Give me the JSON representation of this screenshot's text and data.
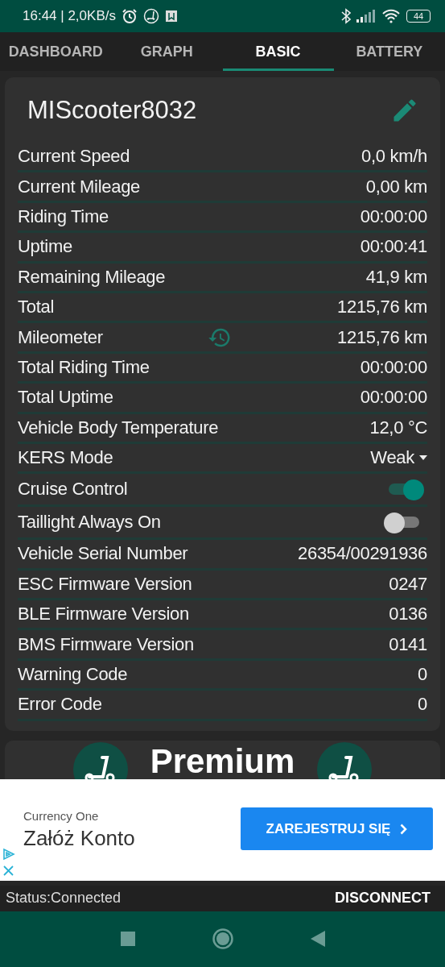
{
  "status_bar": {
    "time": "16:44 | 2,0KB/s",
    "battery": "44"
  },
  "tabs": [
    {
      "label": "DASHBOARD",
      "selected": false
    },
    {
      "label": "GRAPH",
      "selected": false
    },
    {
      "label": "BASIC",
      "selected": true
    },
    {
      "label": "BATTERY",
      "selected": false
    }
  ],
  "device": {
    "name": "MIScooter8032"
  },
  "rows": [
    {
      "kind": "value",
      "label": "Current Speed",
      "value": "0,0 km/h"
    },
    {
      "kind": "value",
      "label": "Current Mileage",
      "value": "0,00 km"
    },
    {
      "kind": "value",
      "label": "Riding Time",
      "value": "00:00:00"
    },
    {
      "kind": "value",
      "label": "Uptime",
      "value": "00:00:41"
    },
    {
      "kind": "value",
      "label": "Remaining Mileage",
      "value": "41,9 km"
    },
    {
      "kind": "value",
      "label": "Total",
      "value": "1215,76 km"
    },
    {
      "kind": "resettable",
      "label": "Mileometer",
      "value": "1215,76 km"
    },
    {
      "kind": "value",
      "label": "Total Riding Time",
      "value": "00:00:00"
    },
    {
      "kind": "value",
      "label": "Total Uptime",
      "value": "00:00:00"
    },
    {
      "kind": "value",
      "label": "Vehicle Body Temperature",
      "value": "12,0 °C"
    },
    {
      "kind": "dropdown",
      "label": "KERS Mode",
      "value": "Weak"
    },
    {
      "kind": "toggle",
      "label": "Cruise Control",
      "on": true
    },
    {
      "kind": "toggle",
      "label": "Taillight Always On",
      "on": false
    },
    {
      "kind": "value",
      "label": "Vehicle Serial Number",
      "value": "26354/00291936"
    },
    {
      "kind": "value",
      "label": "ESC Firmware Version",
      "value": "0247"
    },
    {
      "kind": "value",
      "label": "BLE Firmware Version",
      "value": "0136"
    },
    {
      "kind": "value",
      "label": "BMS Firmware Version",
      "value": "0141"
    },
    {
      "kind": "value",
      "label": "Warning Code",
      "value": "0"
    },
    {
      "kind": "value",
      "label": "Error Code",
      "value": "0"
    }
  ],
  "premium": {
    "title": "Premium"
  },
  "ad": {
    "advertiser": "Currency One",
    "headline": "Załóż Konto",
    "button": "ZAREJESTRUJ SIĘ"
  },
  "connection": {
    "status": "Status:Connected",
    "button": "DISCONNECT"
  }
}
